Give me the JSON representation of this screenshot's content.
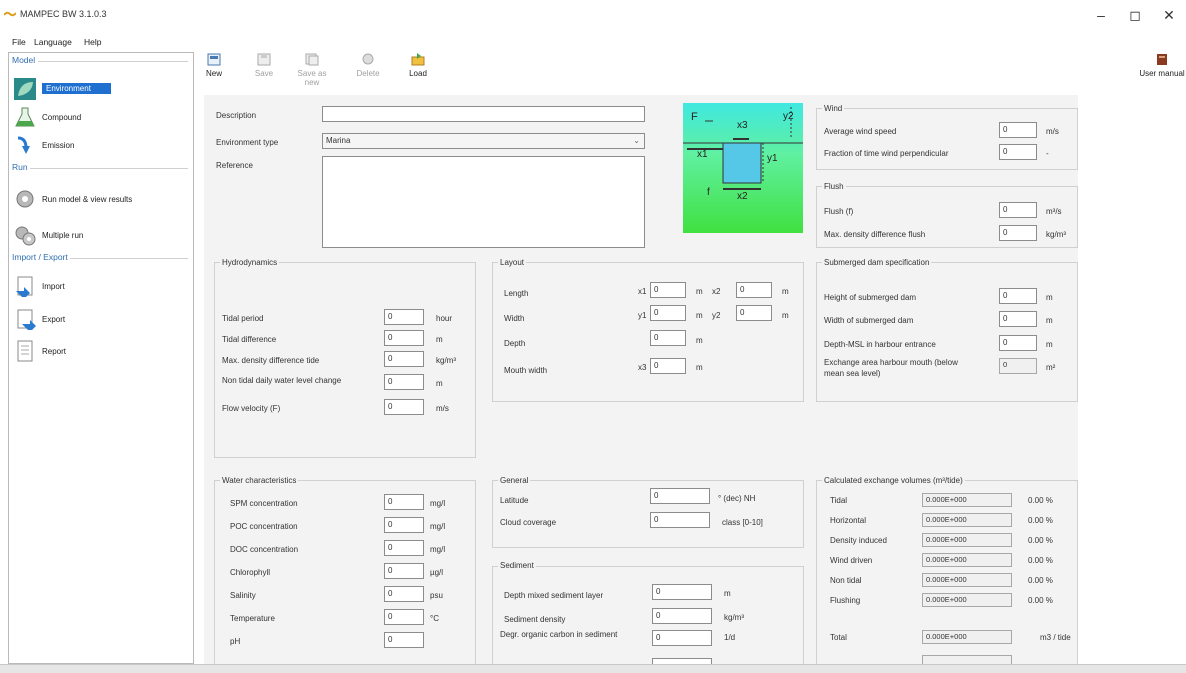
{
  "app": {
    "title": "MAMPEC BW 3.1.0.3"
  },
  "window": {
    "minimize": "–",
    "maximize": "◻",
    "close": "✕"
  },
  "menu": [
    "File",
    "Language",
    "Help"
  ],
  "sidebar": {
    "groups": {
      "model": "Model",
      "run": "Run",
      "import_export": "Import / Export"
    },
    "items": [
      {
        "label": "Environment",
        "icon": "leaf-icon"
      },
      {
        "label": "Compound",
        "icon": "flask-icon"
      },
      {
        "label": "Emission",
        "icon": "emission-arrow-icon"
      },
      {
        "label": "Run model & view results",
        "icon": "gears-icon"
      },
      {
        "label": "Multiple run",
        "icon": "multiple-gears-icon"
      },
      {
        "label": "Import",
        "icon": "import-icon"
      },
      {
        "label": "Export",
        "icon": "export-icon"
      },
      {
        "label": "Report",
        "icon": "report-icon"
      }
    ]
  },
  "toolbar": {
    "new": "New",
    "save": "Save",
    "save_as_new": "Save as new",
    "delete": "Delete",
    "load": "Load",
    "user_manual": "User manual"
  },
  "top_form": {
    "description_label": "Description",
    "description_value": "",
    "environment_type_label": "Environment type",
    "environment_type_value": "Marina",
    "reference_label": "Reference",
    "reference_value": ""
  },
  "diagram": {
    "F": "F",
    "x1": "x1",
    "x2": "x2",
    "x3": "x3",
    "y1": "y1",
    "y2": "y2",
    "f": "f"
  },
  "wind": {
    "title": "Wind",
    "avg_speed_label": "Average wind speed",
    "avg_speed_value": "0",
    "avg_speed_unit": "m/s",
    "fraction_label": "Fraction of time wind perpendicular",
    "fraction_value": "0",
    "fraction_unit": "-"
  },
  "flush": {
    "title": "Flush",
    "flush_label": "Flush (f)",
    "flush_value": "0",
    "flush_unit": "m³/s",
    "density_label": "Max. density difference flush",
    "density_value": "0",
    "density_unit": "kg/m³"
  },
  "hydrodynamics": {
    "title": "Hydrodynamics",
    "rows": [
      {
        "label": "Tidal period",
        "value": "0",
        "unit": "hour"
      },
      {
        "label": "Tidal difference",
        "value": "0",
        "unit": "m"
      },
      {
        "label": "Max. density difference tide",
        "value": "0",
        "unit": "kg/m³"
      },
      {
        "label": "Non tidal daily water level change",
        "value": "0",
        "unit": "m"
      },
      {
        "label": "Flow velocity (F)",
        "value": "0",
        "unit": "m/s"
      }
    ]
  },
  "layout": {
    "title": "Layout",
    "length_label": "Length",
    "x1_label": "x1",
    "x1_value": "0",
    "x1_unit": "m",
    "x2_label": "x2",
    "x2_value": "0",
    "x2_unit": "m",
    "width_label": "Width",
    "y1_label": "y1",
    "y1_value": "0",
    "y1_unit": "m",
    "y2_label": "y2",
    "y2_value": "0",
    "y2_unit": "m",
    "depth_label": "Depth",
    "depth_value": "0",
    "depth_unit": "m",
    "mouth_label": "Mouth width",
    "x3_label": "x3",
    "x3_value": "0",
    "x3_unit": "m"
  },
  "dam": {
    "title": "Submerged dam specification",
    "rows": [
      {
        "label": "Height of submerged dam",
        "value": "0",
        "unit": "m"
      },
      {
        "label": "Width of submerged dam",
        "value": "0",
        "unit": "m"
      },
      {
        "label": "Depth-MSL in harbour entrance",
        "value": "0",
        "unit": "m"
      }
    ],
    "exchange_label_1": "Exchange area harbour mouth (below",
    "exchange_label_2": "mean sea level)",
    "exchange_value": "0",
    "exchange_unit": "m²"
  },
  "water": {
    "title": "Water characteristics",
    "rows": [
      {
        "label": "SPM concentration",
        "value": "0",
        "unit": "mg/l"
      },
      {
        "label": "POC concentration",
        "value": "0",
        "unit": "mg/l"
      },
      {
        "label": "DOC concentration",
        "value": "0",
        "unit": "mg/l"
      },
      {
        "label": "Chlorophyll",
        "value": "0",
        "unit": "µg/l"
      },
      {
        "label": "Salinity",
        "value": "0",
        "unit": "psu"
      },
      {
        "label": "Temperature",
        "value": "0",
        "unit": "°C"
      },
      {
        "label": "pH",
        "value": "0",
        "unit": ""
      }
    ]
  },
  "general": {
    "title": "General",
    "latitude_label": "Latitude",
    "latitude_value": "0",
    "latitude_unit": "° (dec) NH",
    "cloud_label": "Cloud coverage",
    "cloud_value": "0",
    "cloud_unit": "class [0-10]"
  },
  "sediment": {
    "title": "Sediment",
    "rows": [
      {
        "label": "Depth mixed sediment layer",
        "value": "0",
        "unit": "m"
      },
      {
        "label": "Sediment density",
        "value": "0",
        "unit": "kg/m³"
      },
      {
        "label": "Degr. organic carbon in sediment",
        "value": "0",
        "unit": "1/d"
      }
    ]
  },
  "exchange": {
    "title": "Calculated exchange volumes (m³/tide)",
    "rows": [
      {
        "label": "Tidal",
        "value": "0.000E+000",
        "pct": "0.00 %"
      },
      {
        "label": "Horizontal",
        "value": "0.000E+000",
        "pct": "0.00 %"
      },
      {
        "label": "Density induced",
        "value": "0.000E+000",
        "pct": "0.00 %"
      },
      {
        "label": "Wind driven",
        "value": "0.000E+000",
        "pct": "0.00 %"
      },
      {
        "label": "Non tidal",
        "value": "0.000E+000",
        "pct": "0.00 %"
      },
      {
        "label": "Flushing",
        "value": "0.000E+000",
        "pct": "0.00 %"
      }
    ],
    "total_label": "Total",
    "total_value": "0.000E+000",
    "total_unit": "m3 / tide"
  }
}
